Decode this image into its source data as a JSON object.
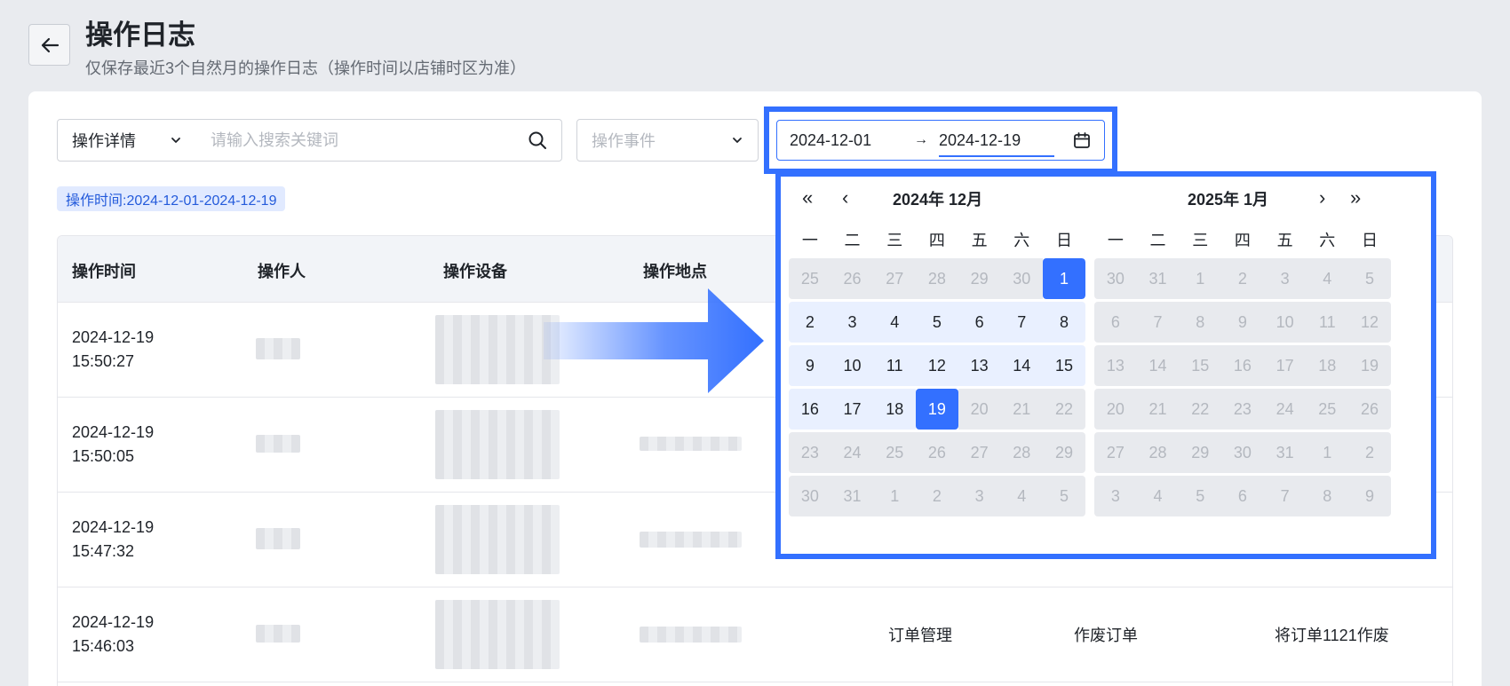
{
  "header": {
    "title": "操作日志",
    "subtitle": "仅保存最近3个自然月的操作日志（操作时间以店铺时区为准）"
  },
  "filters": {
    "detail_select_label": "操作详情",
    "search_placeholder": "请输入搜索关键词",
    "event_placeholder": "操作事件",
    "date_start": "2024-12-01",
    "date_separator": "→",
    "date_end": "2024-12-19",
    "active_tag": "操作时间:2024-12-01-2024-12-19"
  },
  "table": {
    "columns": [
      "操作时间",
      "操作人",
      "操作设备",
      "操作地点"
    ],
    "rows": [
      {
        "date": "2024-12-19",
        "time": "15:50:27",
        "module": "",
        "action": "",
        "detail": ""
      },
      {
        "date": "2024-12-19",
        "time": "15:50:05",
        "module": "",
        "action": "",
        "detail": ""
      },
      {
        "date": "2024-12-19",
        "time": "15:47:32",
        "module": "",
        "action": "",
        "detail": ""
      },
      {
        "date": "2024-12-19",
        "time": "15:46:03",
        "module": "订单管理",
        "action": "作废订单",
        "detail": "将订单1121作废"
      }
    ]
  },
  "calendar": {
    "left_title": "2024年  12月",
    "right_title": "2025年  1月",
    "weekdays": [
      "一",
      "二",
      "三",
      "四",
      "五",
      "六",
      "日"
    ],
    "left_weeks": [
      [
        "25",
        "26",
        "27",
        "28",
        "29",
        "30",
        "1"
      ],
      [
        "2",
        "3",
        "4",
        "5",
        "6",
        "7",
        "8"
      ],
      [
        "9",
        "10",
        "11",
        "12",
        "13",
        "14",
        "15"
      ],
      [
        "16",
        "17",
        "18",
        "19",
        "20",
        "21",
        "22"
      ],
      [
        "23",
        "24",
        "25",
        "26",
        "27",
        "28",
        "29"
      ],
      [
        "30",
        "31",
        "1",
        "2",
        "3",
        "4",
        "5"
      ]
    ],
    "right_weeks": [
      [
        "30",
        "31",
        "1",
        "2",
        "3",
        "4",
        "5"
      ],
      [
        "6",
        "7",
        "8",
        "9",
        "10",
        "11",
        "12"
      ],
      [
        "13",
        "14",
        "15",
        "16",
        "17",
        "18",
        "19"
      ],
      [
        "20",
        "21",
        "22",
        "23",
        "24",
        "25",
        "26"
      ],
      [
        "27",
        "28",
        "29",
        "30",
        "31",
        "1",
        "2"
      ],
      [
        "3",
        "4",
        "5",
        "6",
        "7",
        "8",
        "9"
      ]
    ],
    "left_day_states": [
      [
        "out",
        "out",
        "out",
        "out",
        "out",
        "out",
        "sel"
      ],
      [
        "in",
        "in",
        "in",
        "in",
        "in",
        "in",
        "in"
      ],
      [
        "in",
        "in",
        "in",
        "in",
        "in",
        "in",
        "in"
      ],
      [
        "in",
        "in",
        "in",
        "sel",
        "out",
        "out",
        "out"
      ],
      [
        "out",
        "out",
        "out",
        "out",
        "out",
        "out",
        "out"
      ],
      [
        "out",
        "out",
        "out",
        "out",
        "out",
        "out",
        "out"
      ]
    ]
  },
  "colors": {
    "accent": "#3370ff",
    "highlight": "#3370ff",
    "range_bg": "#e9f0ff"
  },
  "icons": {
    "back": "arrow-left-icon",
    "search": "search-icon",
    "chevron": "chevron-down-icon",
    "calendar": "calendar-icon",
    "prev_year": "double-chevron-left-icon",
    "prev_month": "chevron-left-icon",
    "next_month": "chevron-right-icon",
    "next_year": "double-chevron-right-icon"
  }
}
